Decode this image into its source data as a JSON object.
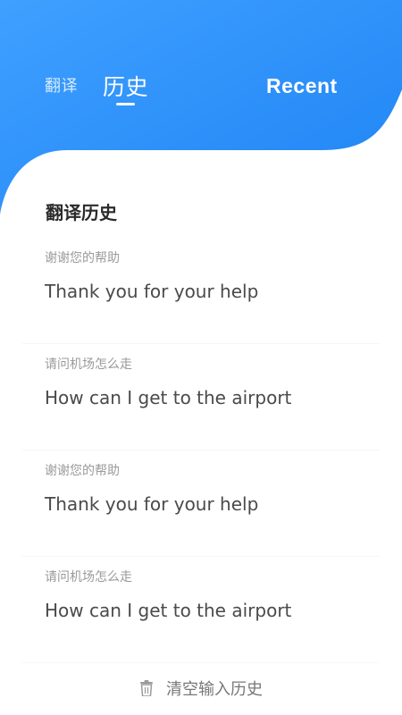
{
  "colors": {
    "accent": "#1f84f5",
    "accent_light": "#3fa0ff",
    "title_text": "#2b2b2b",
    "secondary_text": "#9a9a9a",
    "primary_text": "#4a4a4a"
  },
  "tabs": {
    "translate_label": "翻译",
    "history_label": "历史",
    "active": "history"
  },
  "header": {
    "recent_label": "Recent"
  },
  "section": {
    "title": "翻译历史"
  },
  "history": {
    "items": [
      {
        "source": "谢谢您的帮助",
        "target": "Thank you for your help"
      },
      {
        "source": "请问机场怎么走",
        "target": "How can I get to the airport"
      },
      {
        "source": "谢谢您的帮助",
        "target": "Thank you for your help"
      },
      {
        "source": "请问机场怎么走",
        "target": "How can I get to the airport"
      }
    ]
  },
  "footer": {
    "clear_icon": "trash-icon",
    "clear_label": "清空输入历史"
  }
}
